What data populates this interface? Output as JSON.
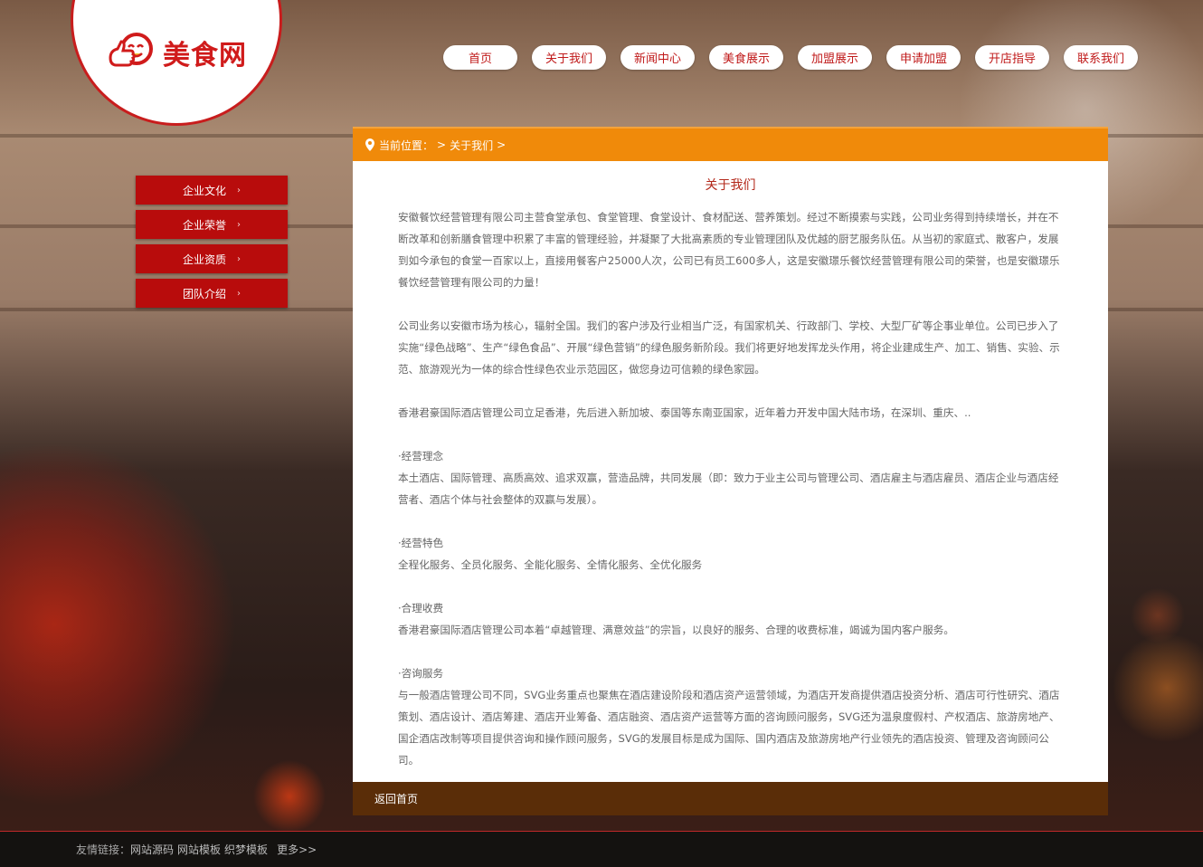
{
  "brand": {
    "logo_text": "美食网"
  },
  "nav": [
    {
      "label": "首页"
    },
    {
      "label": "关于我们"
    },
    {
      "label": "新闻中心"
    },
    {
      "label": "美食展示"
    },
    {
      "label": "加盟展示"
    },
    {
      "label": "申请加盟"
    },
    {
      "label": "开店指导"
    },
    {
      "label": "联系我们"
    }
  ],
  "sidebar": {
    "items": [
      {
        "label": "企业文化"
      },
      {
        "label": "企业荣誉"
      },
      {
        "label": "企业资质"
      },
      {
        "label": "团队介绍"
      }
    ],
    "arrow": "›"
  },
  "breadcrumb": {
    "prefix": "当前位置：",
    "sep1": ">",
    "current": "关于我们",
    "sep2": ">"
  },
  "article": {
    "title": "关于我们",
    "paragraphs": [
      "安徽餐饮经营管理有限公司主营食堂承包、食堂管理、食堂设计、食材配送、营养策划。经过不断摸索与实践，公司业务得到持续增长，并在不断改革和创新膳食管理中积累了丰富的管理经验，并凝聚了大批高素质的专业管理团队及优越的厨艺服务队伍。从当初的家庭式、散客户，发展到如今承包的食堂一百家以上，直接用餐客户25000人次，公司已有员工600多人，这是安徽璟乐餐饮经营管理有限公司的荣誉，也是安徽璟乐餐饮经营管理有限公司的力量！",
      "公司业务以安徽市场为核心，辐射全国。我们的客户涉及行业相当广泛，有国家机关、行政部门、学校、大型厂矿等企事业单位。公司已步入了实施“绿色战略”、生产“绿色食品”、开展“绿色营销”的绿色服务新阶段。我们将更好地发挥龙头作用，将企业建成生产、加工、销售、实验、示范、旅游观光为一体的综合性绿色农业示范园区，做您身边可信赖的绿色家园。",
      "香港君豪国际酒店管理公司立足香港，先后进入新加坡、泰国等东南亚国家，近年着力开发中国大陆市场，在深圳、重庆、..",
      "·经营理念",
      "本土酒店、国际管理、高质高效、追求双赢，营造品牌，共同发展（即：致力于业主公司与管理公司、酒店雇主与酒店雇员、酒店企业与酒店经营者、酒店个体与社会整体的双赢与发展）。",
      "·经营特色",
      "全程化服务、全员化服务、全能化服务、全情化服务、全优化服务",
      "·合理收费",
      "香港君豪国际酒店管理公司本着“卓越管理、满意效益”的宗旨，以良好的服务、合理的收费标准，竭诚为国内客户服务。",
      "·咨询服务",
      "与一般酒店管理公司不同，SVG业务重点也聚焦在酒店建设阶段和酒店资产运营领域，为酒店开发商提供酒店投资分析、酒店可行性研究、酒店策划、酒店设计、酒店筹建、酒店开业筹备、酒店融资、酒店资产运营等方面的咨询顾问服务，SVG还为温泉度假村、产权酒店、旅游房地产、国企酒店改制等项目提供咨询和操作顾问服务，SVG的发展目标是成为国际、国内酒店及旅游房地产行业领先的酒店投资、管理及咨询顾问公司。"
    ],
    "back_label": "返回首页"
  },
  "footer": {
    "prefix": "友情链接：",
    "links": [
      "网站源码",
      "网站模板",
      "织梦模板"
    ],
    "more": "更多>>"
  },
  "colors": {
    "accent_red": "#c01a1a",
    "breadcrumb_orange": "#f08a0a",
    "footer_brown": "#5a2d08"
  }
}
